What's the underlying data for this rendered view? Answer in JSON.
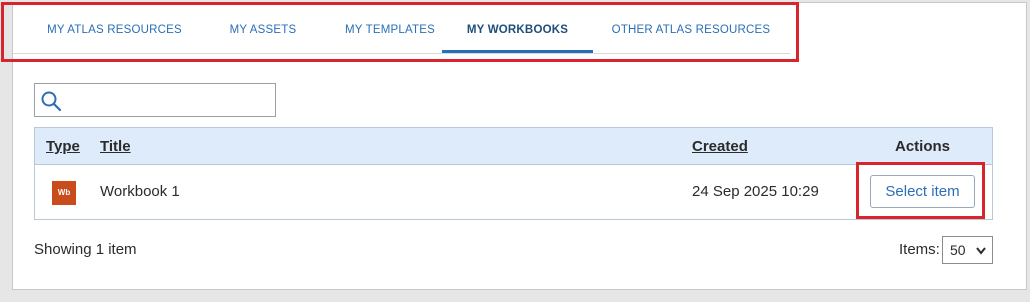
{
  "tabs": [
    {
      "label": "MY ATLAS RESOURCES",
      "active": false
    },
    {
      "label": "MY ASSETS",
      "active": false
    },
    {
      "label": "MY TEMPLATES",
      "active": false
    },
    {
      "label": "MY WORKBOOKS",
      "active": true
    },
    {
      "label": "OTHER ATLAS RESOURCES",
      "active": false
    }
  ],
  "search": {
    "value": "",
    "icon": "search-icon"
  },
  "table": {
    "headers": {
      "type": "Type",
      "title": "Title",
      "created": "Created",
      "actions": "Actions"
    },
    "rows": [
      {
        "type_icon_text": "Wb",
        "title": "Workbook 1",
        "created": "24 Sep 2025 10:29",
        "action_label": "Select item"
      }
    ]
  },
  "footer": {
    "showing": "Showing 1 item",
    "items_label": "Items:",
    "items_per_page": "50"
  },
  "colors": {
    "accent": "#2a6fb5",
    "header_bg": "#deebfa",
    "highlight": "#d9232d",
    "workbook_icon": "#c94d1c"
  }
}
